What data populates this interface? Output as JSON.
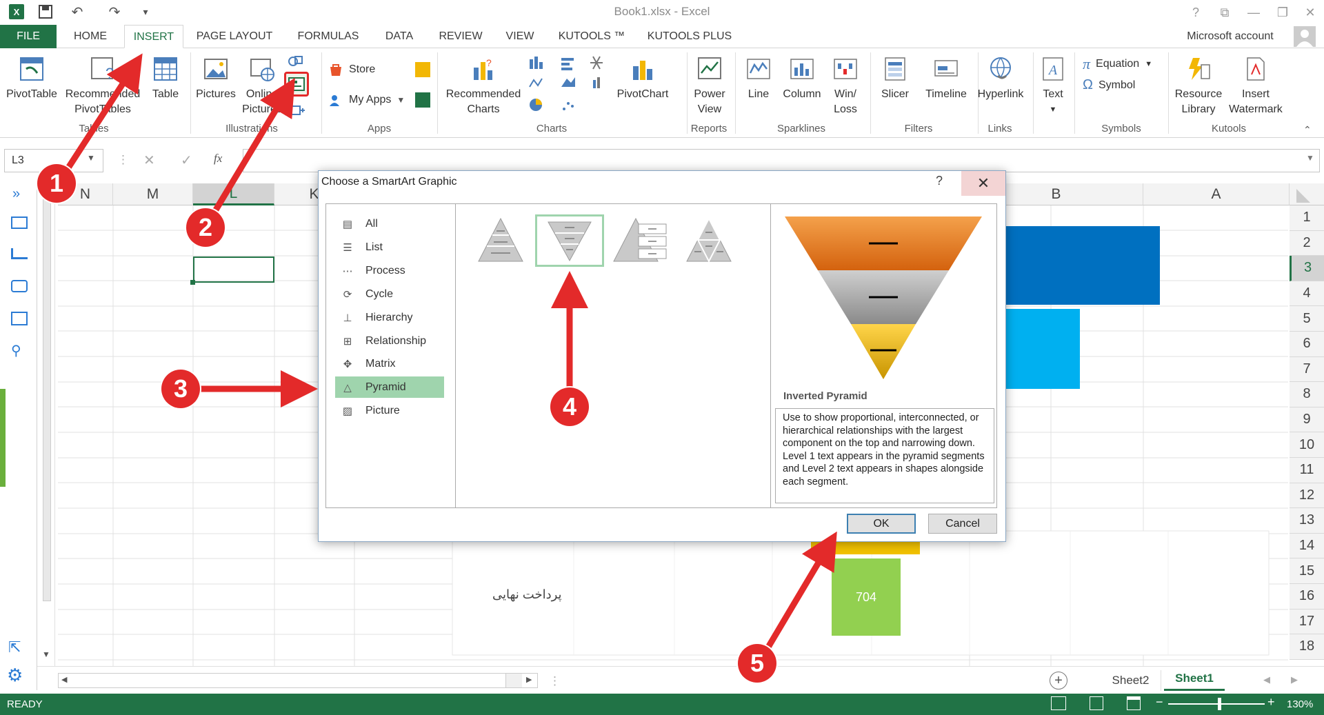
{
  "window": {
    "title": "Book1.xlsx - Excel",
    "account": "Microsoft account"
  },
  "tabs": [
    "FILE",
    "HOME",
    "INSERT",
    "PAGE LAYOUT",
    "FORMULAS",
    "DATA",
    "REVIEW",
    "VIEW",
    "KUTOOLS ™",
    "KUTOOLS PLUS"
  ],
  "ribbon": {
    "tables": {
      "pivot": "PivotTable",
      "recommended": "Recommended\nPivotTables",
      "table": "Table",
      "group": "Tables"
    },
    "illustrations": {
      "pictures": "Pictures",
      "online": "Online\nPictures",
      "group": "Illustrations"
    },
    "apps": {
      "store": "Store",
      "myapps": "My Apps",
      "group": "Apps"
    },
    "charts": {
      "recommended": "Recommended\nCharts",
      "pivotchart": "PivotChart",
      "group": "Charts"
    },
    "reports": {
      "powerview": "Power\nView",
      "group": "Reports"
    },
    "sparklines": {
      "line": "Line",
      "column": "Column",
      "winloss": "Win/\nLoss",
      "group": "Sparklines"
    },
    "filters": {
      "slicer": "Slicer",
      "timeline": "Timeline",
      "group": "Filters"
    },
    "links": {
      "hyperlink": "Hyperlink",
      "group": "Links"
    },
    "text": {
      "text": "Text"
    },
    "symbols": {
      "equation": "Equation",
      "symbol": "Symbol",
      "group": "Symbols"
    },
    "kutools": {
      "resource": "Resource\nLibrary",
      "watermark": "Insert\nWatermark",
      "group": "Kutools"
    }
  },
  "formula_bar": {
    "name_box": "L3",
    "fx": "fx"
  },
  "columns": [
    "N",
    "M",
    "L",
    "K",
    "B",
    "A"
  ],
  "rows": [
    "1",
    "2",
    "3",
    "4",
    "5",
    "6",
    "7",
    "8",
    "9",
    "10",
    "11",
    "12",
    "13",
    "14",
    "15",
    "16",
    "17",
    "18"
  ],
  "sheet_content": {
    "persian_label": "پرداخت نهایی",
    "green_value": "704"
  },
  "dialog": {
    "title": "Choose a SmartArt Graphic",
    "help": "?",
    "categories": [
      "All",
      "List",
      "Process",
      "Cycle",
      "Hierarchy",
      "Relationship",
      "Matrix",
      "Pyramid",
      "Picture"
    ],
    "selected_category": "Pyramid",
    "preview_name": "Inverted Pyramid",
    "preview_description": "Use to show proportional, interconnected, or hierarchical relationships with the largest component on the top and narrowing down. Level 1 text appears in the pyramid segments and Level 2 text appears in shapes alongside each segment.",
    "ok": "OK",
    "cancel": "Cancel"
  },
  "sheet_tabs": [
    "Sheet2",
    "Sheet1"
  ],
  "active_sheet": "Sheet1",
  "status": {
    "ready": "READY",
    "zoom": "130%"
  },
  "annotations": [
    "1",
    "2",
    "3",
    "4",
    "5"
  ],
  "colors": {
    "excel_green": "#217346",
    "annotation_red": "#e32a2a",
    "selected_category": "#9fd4ad",
    "bar_blue": "#0070c0",
    "bar_lightblue": "#00b0f0",
    "bar_green": "#92d050"
  }
}
